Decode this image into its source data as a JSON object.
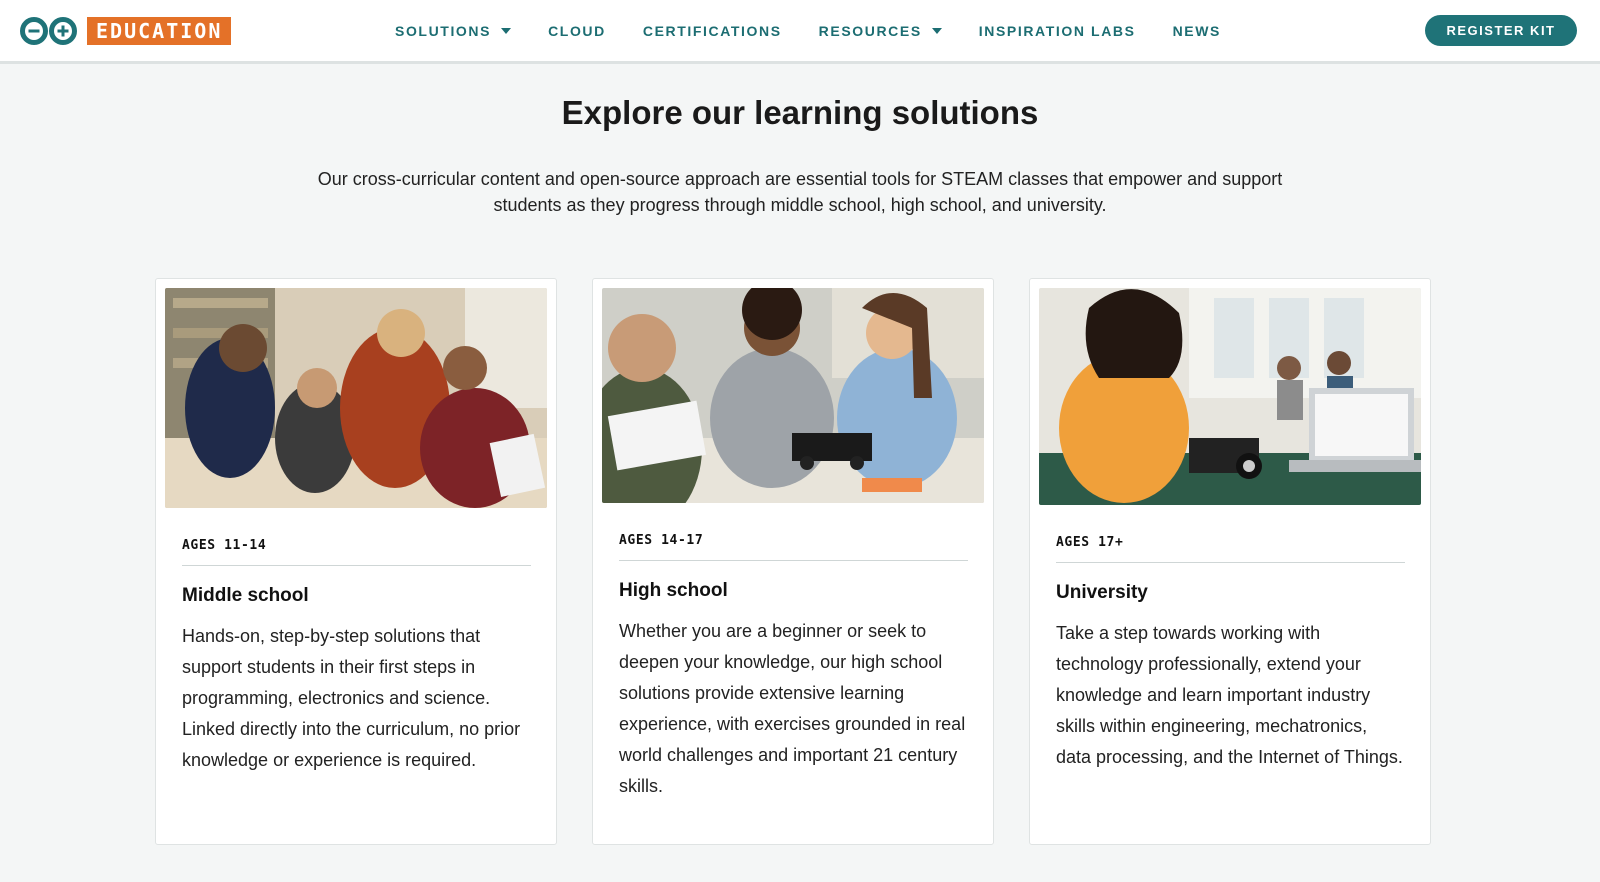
{
  "brand": {
    "logo_icon": "arduino-infinity-logo",
    "word": "EDUCATION"
  },
  "nav": [
    {
      "label": "SOLUTIONS",
      "has_dropdown": true
    },
    {
      "label": "CLOUD",
      "has_dropdown": false
    },
    {
      "label": "CERTIFICATIONS",
      "has_dropdown": false
    },
    {
      "label": "RESOURCES",
      "has_dropdown": true
    },
    {
      "label": "INSPIRATION LABS",
      "has_dropdown": false
    },
    {
      "label": "NEWS",
      "has_dropdown": false
    }
  ],
  "cta": {
    "label": "REGISTER KIT"
  },
  "hero": {
    "title": "Explore our learning solutions",
    "subtitle": "Our cross-curricular content and open-source approach are essential tools for STEAM classes that empower and support students as they progress through middle school, high school, and university."
  },
  "cards": [
    {
      "ages": "AGES 11-14",
      "title": "Middle school",
      "text": "Hands-on, step-by-step solutions that support students in their first steps in programming, electronics and science. Linked directly into the curriculum, no prior knowledge or experience is required.",
      "image": "photo-middle-school-students-with-teacher"
    },
    {
      "ages": "AGES 14-17",
      "title": "High school",
      "text": "Whether you are a beginner or seek to deepen your knowledge, our high school solutions provide extensive learning experience, with exercises grounded in real world challenges and important 21 century skills.",
      "image": "photo-high-school-students-building-robot"
    },
    {
      "ages": "AGES 17+",
      "title": "University",
      "text": "Take a step towards working with technology professionally, extend your knowledge and learn important industry skills within engineering, mechatronics, data processing, and the Internet of Things.",
      "image": "photo-university-student-with-robot-car"
    }
  ],
  "colors": {
    "brand_orange": "#e47128",
    "teal": "#1c6d72",
    "page_bg": "#f4f6f6"
  }
}
